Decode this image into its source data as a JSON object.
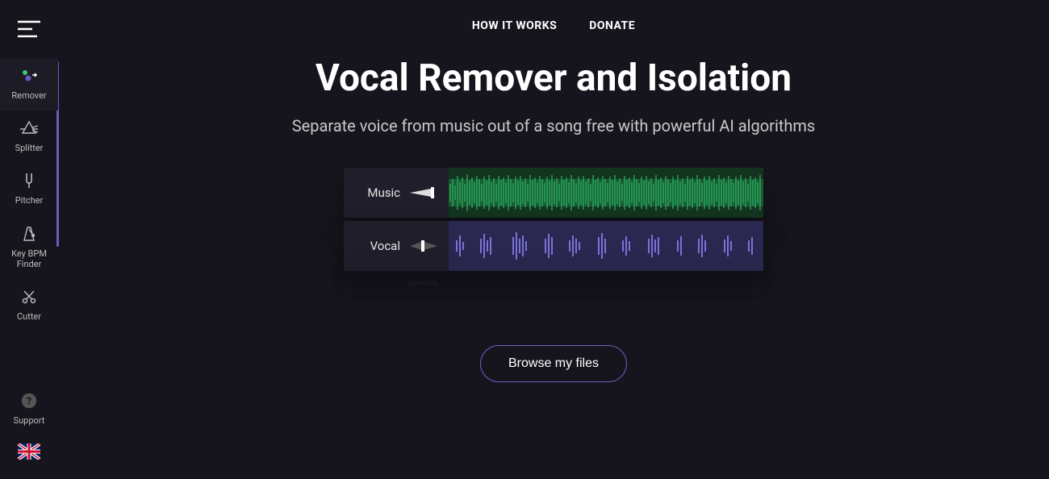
{
  "nav": {
    "how": "HOW IT WORKS",
    "donate": "DONATE"
  },
  "hero": {
    "title": "Vocal Remover and Isolation",
    "subtitle": "Separate voice from music out of a song free with powerful AI algorithms"
  },
  "waveform": {
    "music_label": "Music",
    "vocal_label": "Vocal"
  },
  "cta": {
    "browse": "Browse my files"
  },
  "sidebar": {
    "remover": "Remover",
    "splitter": "Splitter",
    "pitcher": "Pitcher",
    "keybpm": "Key BPM Finder",
    "cutter": "Cutter",
    "support": "Support"
  }
}
